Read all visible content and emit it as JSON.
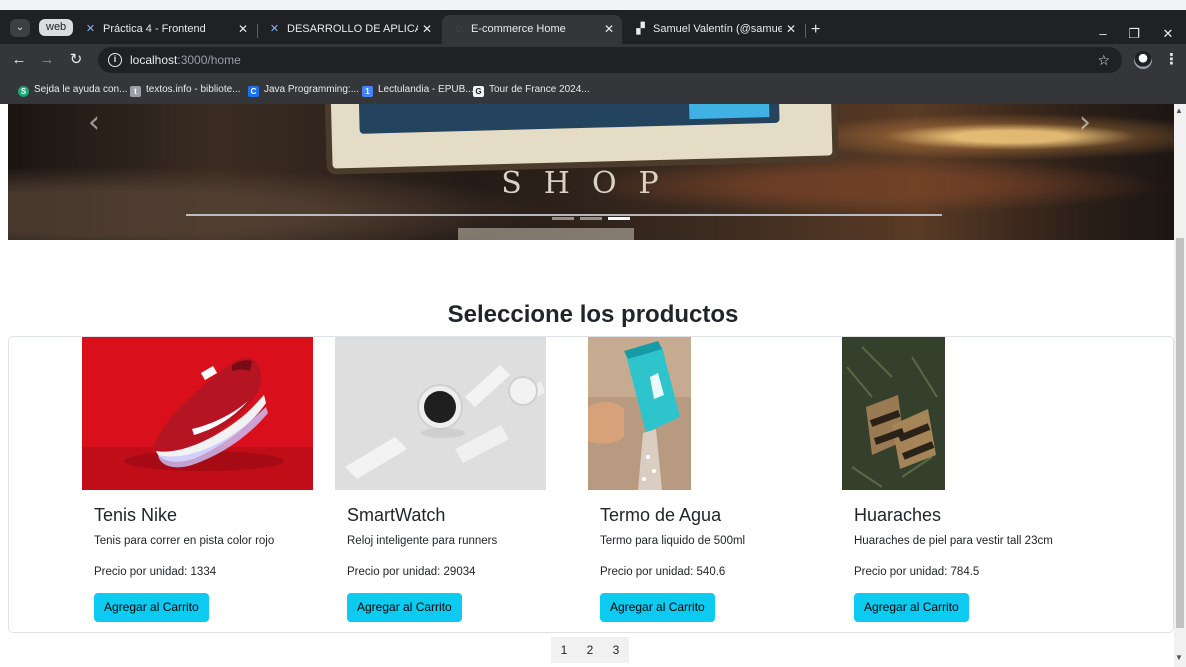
{
  "browser": {
    "tab_search_icon": "chevron-down-icon",
    "tab_group_label": "web",
    "tabs": [
      {
        "title": "Práctica 4 - Frontend",
        "icon": "vscode-icon",
        "active": false
      },
      {
        "title": "DESARROLLO DE APLICACIONE",
        "icon": "vscode-icon",
        "active": false
      },
      {
        "title": "E-commerce Home",
        "icon": "globe-icon",
        "active": true
      },
      {
        "title": "Samuel Valentín (@samuel_vale",
        "icon": "profile-icon",
        "active": false
      }
    ],
    "new_tab": "+",
    "window_controls": {
      "minimize": "–",
      "restore": "❐",
      "close": "✕"
    },
    "url_host": "localhost",
    "url_path": ":3000/home",
    "bookmarks": [
      {
        "label": "Sejda le ayuda con...",
        "color": "#19a974",
        "glyph": "S"
      },
      {
        "label": "textos.info - bibliote...",
        "color": "#9aa0a6",
        "glyph": "t"
      },
      {
        "label": "Java Programming:...",
        "color": "#1a73e8",
        "glyph": "C"
      },
      {
        "label": "Lectulandia - EPUB...",
        "color": "#4285f4",
        "glyph": "1"
      },
      {
        "label": "Tour de France 2024...",
        "color": "#f1f3f4",
        "glyph": "G"
      }
    ]
  },
  "carousel": {
    "prev": "‹",
    "next": "›",
    "sign_text": "SHOP",
    "indicator_count": 3,
    "active_indicator": 3
  },
  "section_title": "Seleccione los productos",
  "products": [
    {
      "name": "Tenis Nike",
      "description": "Tenis para correr en pista color rojo",
      "price_label": "Precio por unidad: 1334",
      "button": "Agregar al Carrito",
      "image": "red-sneaker-image"
    },
    {
      "name": "SmartWatch",
      "description": "Reloj inteligente para runners",
      "price_label": "Precio por unidad: 29034",
      "button": "Agregar al Carrito",
      "image": "white-smartwatch-image"
    },
    {
      "name": "Termo de Agua",
      "description": "Termo para liquido de 500ml",
      "price_label": "Precio por unidad: 540.6",
      "button": "Agregar al Carrito",
      "image": "teal-bottle-image"
    },
    {
      "name": "Huaraches",
      "description": "Huaraches de piel para vestir tall 23cm",
      "price_label": "Precio por unidad: 784.5",
      "button": "Agregar al Carrito",
      "image": "sandals-image"
    }
  ],
  "pagination": [
    "1",
    "2",
    "3"
  ],
  "colors": {
    "accent_button": "#0dcaf0",
    "chrome_bg": "#35363a",
    "tabbar_bg": "#202124"
  }
}
